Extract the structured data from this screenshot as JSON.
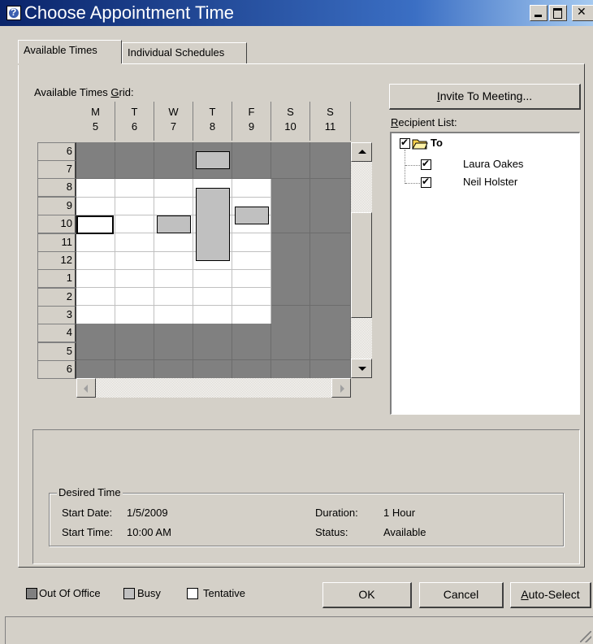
{
  "window": {
    "title": "Choose Appointment Time"
  },
  "tabs": [
    {
      "label": "Available Times",
      "active": true
    },
    {
      "label": "Individual Schedules",
      "active": false
    }
  ],
  "grid": {
    "label_pre": "Available Times ",
    "label_u": "G",
    "label_post": "rid:",
    "days": [
      {
        "day": "M",
        "date": "5"
      },
      {
        "day": "T",
        "date": "6"
      },
      {
        "day": "W",
        "date": "7"
      },
      {
        "day": "T",
        "date": "8"
      },
      {
        "day": "F",
        "date": "9"
      },
      {
        "day": "S",
        "date": "10"
      },
      {
        "day": "S",
        "date": "11"
      }
    ],
    "hours": [
      "6",
      "7",
      "8",
      "9",
      "10",
      "11",
      "12",
      "1",
      "2",
      "3",
      "4",
      "5",
      "6"
    ]
  },
  "invite": {
    "label_u": "I",
    "label_rest": "nvite To Meeting..."
  },
  "recipients": {
    "label_u": "R",
    "label_rest": "ecipient List:",
    "group": "To",
    "people": [
      "Laura Oakes",
      "Neil Holster"
    ]
  },
  "desired": {
    "legend": "Desired Time",
    "start_date_label": "Start Date:",
    "start_date": "1/5/2009",
    "start_time_label": "Start Time:",
    "start_time": "10:00 AM",
    "duration_label": "Duration:",
    "duration": "1 Hour",
    "status_label": "Status:",
    "status": "Available"
  },
  "legend": {
    "ooo": "Out Of Office",
    "busy": "Busy",
    "tentative": "Tentative"
  },
  "buttons": {
    "ok": "OK",
    "cancel": "Cancel",
    "autoselect_u": "A",
    "autoselect_rest": "uto-Select"
  },
  "colors": {
    "title_start": "#0a246a",
    "title_end": "#a6caf0",
    "out_of_office": "#808080",
    "busy": "#c0c0c0"
  }
}
